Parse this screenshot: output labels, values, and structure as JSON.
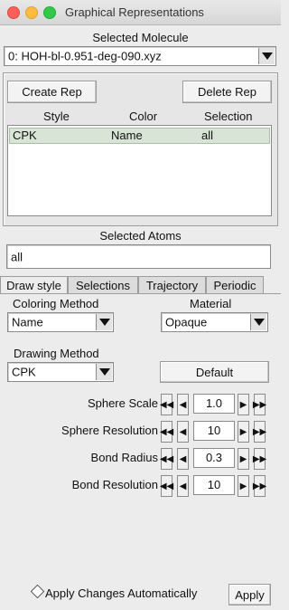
{
  "window": {
    "title": "Graphical Representations"
  },
  "molecule": {
    "heading": "Selected Molecule",
    "selected": "0: HOH-bl-0.951-deg-090.xyz"
  },
  "reps": {
    "create_label": "Create Rep",
    "delete_label": "Delete Rep",
    "headers": {
      "style": "Style",
      "color": "Color",
      "selection": "Selection"
    },
    "rows": [
      {
        "style": "CPK",
        "color": "Name",
        "selection": "all"
      }
    ]
  },
  "atoms": {
    "heading": "Selected Atoms",
    "value": "all"
  },
  "tabs": [
    "Draw style",
    "Selections",
    "Trajectory",
    "Periodic"
  ],
  "draw": {
    "coloring_label": "Coloring Method",
    "coloring_value": "Name",
    "material_label": "Material",
    "material_value": "Opaque",
    "drawing_label": "Drawing Method",
    "drawing_value": "CPK",
    "default_label": "Default",
    "spinners": [
      {
        "label": "Sphere Scale",
        "value": "1.0"
      },
      {
        "label": "Sphere Resolution",
        "value": "10"
      },
      {
        "label": "Bond Radius",
        "value": "0.3"
      },
      {
        "label": "Bond Resolution",
        "value": "10"
      }
    ]
  },
  "footer": {
    "auto_label": "Apply Changes Automatically",
    "apply_label": "Apply"
  }
}
